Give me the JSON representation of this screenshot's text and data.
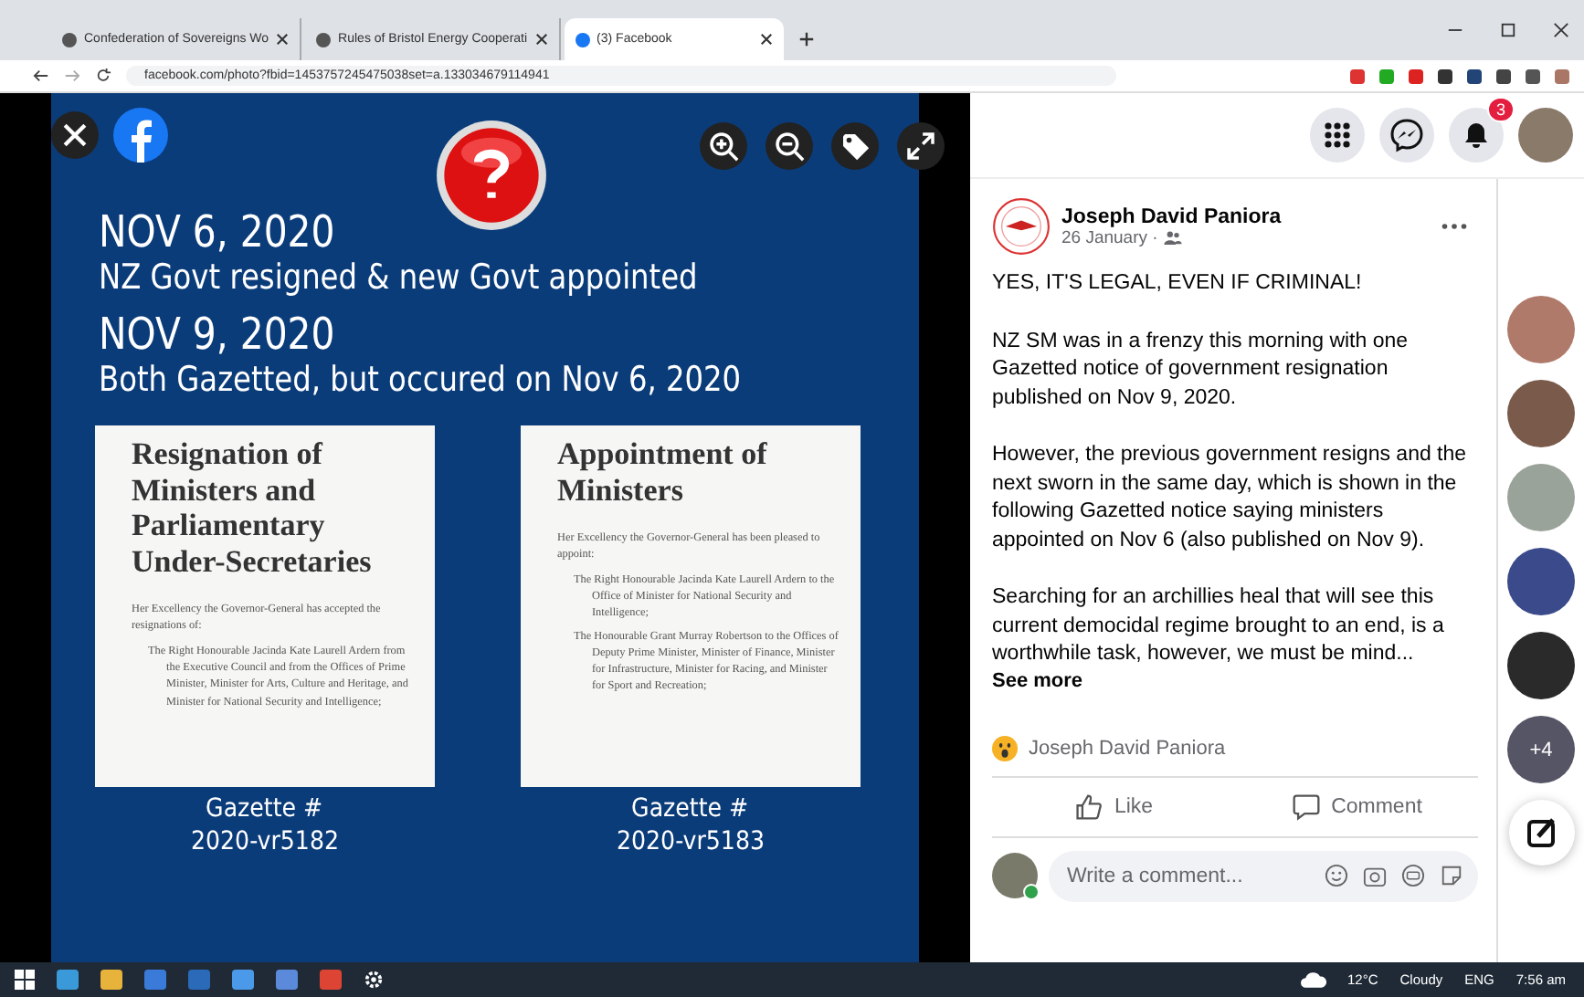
{
  "tabs": [
    {
      "title": "Confederation of Sovereigns Wo",
      "selected": false
    },
    {
      "title": "Rules of Bristol Energy Cooperati",
      "selected": false
    },
    {
      "title": "(3) Facebook",
      "selected": true
    }
  ],
  "address": "facebook.com/photo?fbid=1453757245475038set=a.133034679114941",
  "photo": {
    "headings": [
      {
        "date": "NOV 6, 2020",
        "text": "NZ Govt resigned & new Govt appointed"
      },
      {
        "date": "NOV 9, 2020",
        "text": "Both Gazetted, but occured on Nov 6, 2020"
      }
    ],
    "notices": [
      {
        "title": "Resignation of Ministers and Parliamentary Under-Secretaries",
        "intro": "Her Excellency the Governor-General has accepted the resignations of:",
        "entries": [
          "The Right Honourable Jacinda Kate Laurell Ardern from the Executive Council and from the Offices of Prime Minister, Minister for Arts, Culture and Heritage, and Minister for National Security and Intelligence;"
        ],
        "label": "Gazette #",
        "number": "2020-vr5182"
      },
      {
        "title": "Appointment of Ministers",
        "intro": "Her Excellency the Governor-General has been pleased to appoint:",
        "entries": [
          "The Right Honourable Jacinda Kate Laurell Ardern to the Office of Minister for National Security and Intelligence;",
          "The Honourable Grant Murray Robertson to the Offices of Deputy Prime Minister, Minister of Finance, Minister for Infrastructure, Minister for Racing, and Minister for Sport and Recreation;"
        ],
        "label": "Gazette #",
        "number": "2020-vr5183"
      }
    ]
  },
  "notifications": "3",
  "post": {
    "author": "Joseph David Paniora",
    "date": "26 January ·",
    "paragraphs": [
      "YES, IT'S LEGAL, EVEN IF CRIMINAL!",
      "NZ SM was in a frenzy this morning with one Gazetted notice of government resignation published on Nov 9, 2020.",
      "However, the previous government resigns and the next sworn in the same day, which is shown in the following Gazetted notice saying ministers appointed on Nov 6 (also published on Nov 9).",
      "Searching for an archillies heal that will see this current democidal regime brought to an end, is a worthwhile task, however, we must be mind..."
    ],
    "see_more": "See more",
    "reaction": "Joseph David Paniora",
    "actions": [
      "Like",
      "Comment"
    ],
    "comment_placeholder": "Write a comment..."
  },
  "contacts_more": "+4",
  "taskbar": {
    "temperature": "12°C",
    "weather": "Cloudy",
    "language": "ENG",
    "time": "7:56 am"
  }
}
